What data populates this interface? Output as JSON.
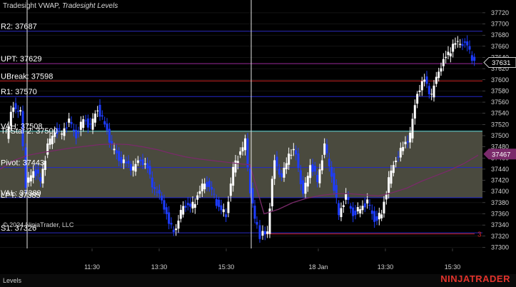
{
  "chart_header": {
    "primary": "Tradesight VWAP",
    "separator": ", ",
    "secondary": "Tradesight Levels"
  },
  "copyright": "© 2024 NinjaTrader, LLC",
  "tab_label": "Levels",
  "brand": "NINJATRADER",
  "colors": {
    "background": "#000000",
    "up_candle": "#ffffff",
    "down_candle": "#1d3cff",
    "vwap": "#7a2a6a",
    "value_area_fill": "#4a4a3e",
    "va_high_line": "#66e0e0",
    "level_line": "#2228c8",
    "r2_line": "#2a2ac0",
    "upt_line": "#9a2a9a",
    "ubreak_line": "#cc2222",
    "s1_line": "#2a2ac0",
    "three_line": "#cc2222",
    "grid": "#262626",
    "session_separator": "#e6e6e6",
    "price_badge_bg": "#000000",
    "vwap_badge_bg": "#7a2a6a",
    "axis_text": "#d0d0d0"
  },
  "chart_data": {
    "type": "candlestick",
    "y_range": [
      37298,
      37725
    ],
    "y_ticks": [
      37300,
      37320,
      37340,
      37360,
      37380,
      37400,
      37420,
      37440,
      37460,
      37480,
      37500,
      37520,
      37540,
      37560,
      37580,
      37600,
      37620,
      37640,
      37660,
      37680,
      37700,
      37720
    ],
    "x_labels": [
      "11:30",
      "13:30",
      "15:30",
      "18 Jan",
      "13:30",
      "15:30"
    ],
    "session_separators": 2,
    "value_area": {
      "high": 37508,
      "low": 37389
    },
    "levels": [
      {
        "label": "R2: 37687",
        "value": 37687,
        "color_key": "r2_line"
      },
      {
        "label": "UPT: 37629",
        "value": 37629,
        "color_key": "upt_line"
      },
      {
        "label": "UBreak: 37598",
        "value": 37598,
        "color_key": "ubreak_line"
      },
      {
        "label": "R1: 37570",
        "value": 37570,
        "color_key": "level_line"
      },
      {
        "label": "VAH: 37508",
        "value": 37508,
        "color_key": "va_high_line"
      },
      {
        "label": "Tr-Star 2: 37500",
        "value": 37500,
        "color_key": null
      },
      {
        "label": "Pivot: 37443",
        "value": 37443,
        "color_key": "level_line"
      },
      {
        "label": "VAL: 37389",
        "value": 37389,
        "color_key": "level_line"
      },
      {
        "label": "LPT: 37385",
        "value": 37385,
        "color_key": null
      },
      {
        "label": "S1: 37326",
        "value": 37326,
        "color_key": "s1_line"
      }
    ],
    "line_end_marker": {
      "label": "3",
      "value": 37324
    },
    "last_price": 37631,
    "vwap_value": 37467,
    "vwap_path": [
      [
        0,
        37440
      ],
      [
        20,
        37456
      ],
      [
        40,
        37465
      ],
      [
        60,
        37470
      ],
      [
        80,
        37474
      ],
      [
        100,
        37478
      ],
      [
        120,
        37481
      ],
      [
        140,
        37484
      ],
      [
        160,
        37485
      ],
      [
        180,
        37484
      ],
      [
        200,
        37480
      ],
      [
        220,
        37475
      ],
      [
        240,
        37468
      ],
      [
        260,
        37462
      ],
      [
        280,
        37458
      ],
      [
        300,
        37455
      ],
      [
        320,
        37452
      ],
      [
        340,
        37449
      ],
      [
        350,
        37448
      ],
      [
        370,
        37360
      ],
      [
        390,
        37368
      ],
      [
        410,
        37380
      ],
      [
        430,
        37388
      ],
      [
        450,
        37393
      ],
      [
        470,
        37396
      ],
      [
        490,
        37396
      ],
      [
        510,
        37394
      ],
      [
        530,
        37392
      ],
      [
        550,
        37398
      ],
      [
        570,
        37406
      ],
      [
        590,
        37418
      ],
      [
        610,
        37428
      ],
      [
        630,
        37438
      ],
      [
        650,
        37450
      ],
      [
        670,
        37465
      ]
    ],
    "price_path": [
      [
        10,
        37500
      ],
      [
        20,
        37555
      ],
      [
        30,
        37540
      ],
      [
        38,
        37410
      ],
      [
        48,
        37440
      ],
      [
        58,
        37420
      ],
      [
        68,
        37480
      ],
      [
        78,
        37510
      ],
      [
        88,
        37505
      ],
      [
        98,
        37525
      ],
      [
        108,
        37500
      ],
      [
        118,
        37530
      ],
      [
        128,
        37515
      ],
      [
        138,
        37550
      ],
      [
        148,
        37520
      ],
      [
        158,
        37480
      ],
      [
        168,
        37460
      ],
      [
        178,
        37450
      ],
      [
        188,
        37440
      ],
      [
        198,
        37460
      ],
      [
        208,
        37440
      ],
      [
        218,
        37400
      ],
      [
        228,
        37390
      ],
      [
        238,
        37340
      ],
      [
        248,
        37330
      ],
      [
        258,
        37380
      ],
      [
        268,
        37370
      ],
      [
        278,
        37390
      ],
      [
        288,
        37420
      ],
      [
        298,
        37400
      ],
      [
        308,
        37370
      ],
      [
        318,
        37360
      ],
      [
        328,
        37440
      ],
      [
        338,
        37470
      ],
      [
        345,
        37490
      ],
      [
        352,
        37400
      ],
      [
        358,
        37350
      ],
      [
        366,
        37320
      ],
      [
        376,
        37330
      ],
      [
        386,
        37460
      ],
      [
        396,
        37420
      ],
      [
        406,
        37470
      ],
      [
        416,
        37470
      ],
      [
        426,
        37390
      ],
      [
        436,
        37450
      ],
      [
        446,
        37420
      ],
      [
        456,
        37480
      ],
      [
        466,
        37430
      ],
      [
        476,
        37360
      ],
      [
        486,
        37390
      ],
      [
        496,
        37360
      ],
      [
        506,
        37370
      ],
      [
        516,
        37380
      ],
      [
        526,
        37350
      ],
      [
        536,
        37360
      ],
      [
        546,
        37420
      ],
      [
        556,
        37460
      ],
      [
        566,
        37480
      ],
      [
        576,
        37500
      ],
      [
        586,
        37580
      ],
      [
        596,
        37600
      ],
      [
        606,
        37570
      ],
      [
        616,
        37620
      ],
      [
        626,
        37640
      ],
      [
        636,
        37660
      ],
      [
        646,
        37670
      ],
      [
        656,
        37660
      ],
      [
        666,
        37630
      ]
    ]
  }
}
